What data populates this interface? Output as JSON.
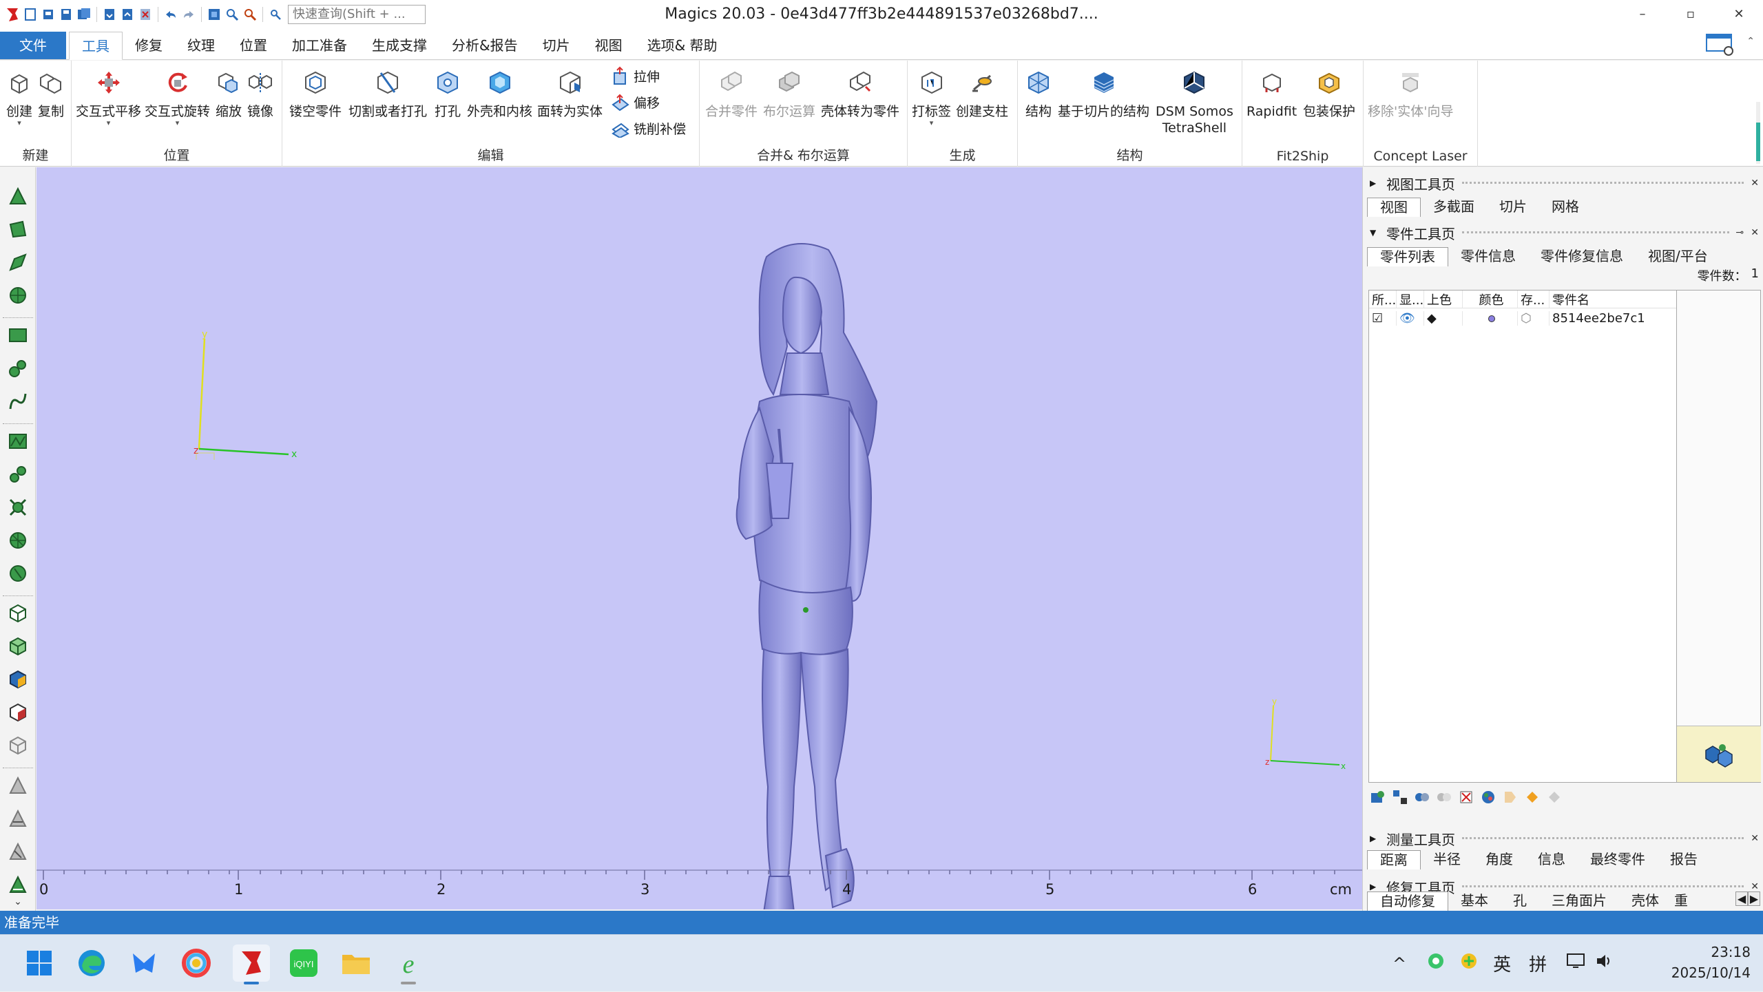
{
  "app": {
    "title": "Magics 20.03 - 0e43d477ff3b2e444891537e03268bd7....",
    "quick_search_placeholder": "快速查询(Shift + ...",
    "window_controls": [
      "–",
      "▫",
      "✕"
    ]
  },
  "menu": {
    "file": "文件",
    "tabs": [
      "工具",
      "修复",
      "纹理",
      "位置",
      "加工准备",
      "生成支撑",
      "分析&报告",
      "切片",
      "视图",
      "选项& 帮助"
    ],
    "active_tab": "工具"
  },
  "ribbon": {
    "groups": {
      "new": "新建",
      "position": "位置",
      "edit": "编辑",
      "merge": "合并& 布尔运算",
      "generate": "生成",
      "structure": "结构",
      "fit2ship": "Fit2Ship",
      "concept": "Concept Laser"
    },
    "buttons": {
      "create": "创建",
      "copy": "复制",
      "interactive_translate": "交互式平移",
      "interactive_rotate": "交互式旋转",
      "scale": "缩放",
      "mirror": "镜像",
      "hollow": "镂空零件",
      "cut_or_punch": "切割或者打孔",
      "punch": "打孔",
      "shell_core": "外壳和内核",
      "surface_to_solid": "面转为实体",
      "extrude": "拉伸",
      "offset": "偏移",
      "milling_comp": "铣削补偿",
      "merge_parts": "合并零件",
      "boolean": "布尔运算",
      "shell_to_part": "壳体转为零件",
      "label": "打标签",
      "create_support": "创建支柱",
      "structure": "结构",
      "slice_structure": "基于切片的结构",
      "dsm_line1": "DSM Somos",
      "dsm_line2": "TetraShell",
      "rapidfit": "Rapidfit",
      "package_protect": "包装保护",
      "remove_solid_wizard": "移除'实体'向导"
    }
  },
  "viewport": {
    "background": "#c7c6f7",
    "model_color": "#a3a6ea",
    "ruler_labels": [
      "0",
      "1",
      "2",
      "3",
      "4",
      "5",
      "6"
    ],
    "ruler_unit": "cm",
    "axis_labels": {
      "x": "x",
      "y": "y",
      "z": "z"
    }
  },
  "right_panel": {
    "view_page": {
      "title": "视图工具页",
      "tabs": [
        "视图",
        "多截面",
        "切片",
        "网格"
      ]
    },
    "part_page": {
      "title": "零件工具页",
      "tabs": [
        "零件列表",
        "零件信息",
        "零件修复信息",
        "视图/平台"
      ],
      "part_count_label": "零件数：",
      "part_count": "1",
      "columns": [
        "所...",
        "显...",
        "上色",
        "颜色",
        "存...",
        "零件名"
      ],
      "rows": [
        {
          "name": "8514ee2be7c1",
          "color": "#8a7fe0"
        }
      ]
    },
    "measure_page": {
      "title": "测量工具页",
      "tabs": [
        "距离",
        "半径",
        "角度",
        "信息",
        "最终零件",
        "报告"
      ]
    },
    "repair_page": {
      "title": "修复工具页",
      "tabs": [
        "自动修复",
        "基本",
        "孔",
        "三角面片",
        "壳体",
        "重"
      ]
    }
  },
  "status": {
    "text": "准备完毕"
  },
  "taskbar": {
    "tray": [
      "^",
      "英",
      "拼"
    ],
    "time": "23:18",
    "date": "2025/10/14"
  },
  "colors": {
    "accent": "#2b78c8",
    "viewport_bg": "#c7c6f7",
    "axis_x": "#27c427",
    "axis_y": "#e0e020",
    "axis_z": "#e03030"
  }
}
